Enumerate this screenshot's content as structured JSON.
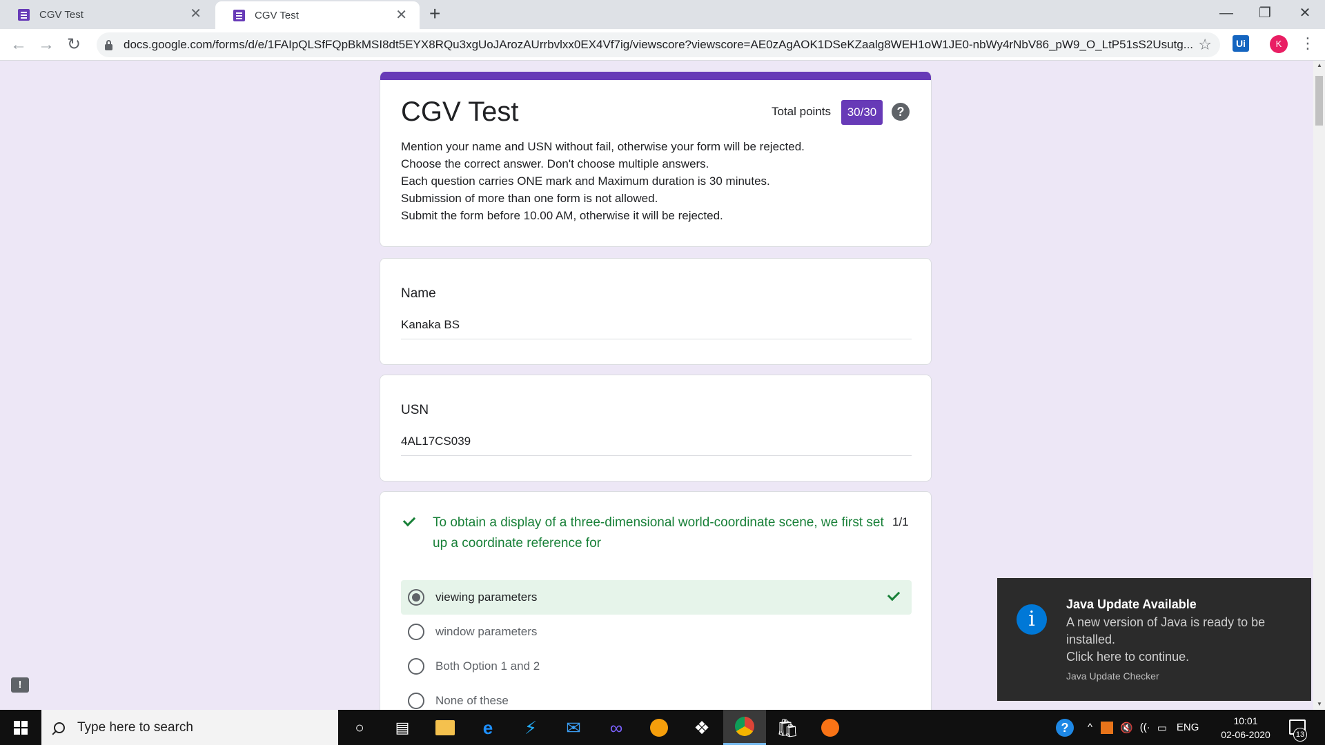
{
  "browser": {
    "tabs": [
      {
        "title": "CGV Test",
        "active": false
      },
      {
        "title": "CGV Test",
        "active": true
      }
    ],
    "new_tab_icon": "plus-icon",
    "window_controls": {
      "minimize": "—",
      "restore": "❐",
      "close": "✕"
    },
    "address": "docs.google.com/forms/d/e/1FAIpQLSfFQpBkMSI8dt5EYX8RQu3xgUoJArozAUrrbvlxx0EX4Vf7ig/viewscore?viewscore=AE0zAgAOK1DSeKZaalg8WEH1oW1JE0-nbWy4rNbV86_pW9_O_LtP51sS2Usutg...",
    "extension_label": "Ui",
    "profile_initial": "K"
  },
  "form": {
    "title": "CGV Test",
    "total_points_label": "Total points",
    "score": "30/30",
    "help_glyph": "?",
    "description": [
      "Mention your name and USN without fail, otherwise your form will be rejected.",
      "Choose the correct answer. Don't choose multiple answers.",
      "Each question carries ONE mark and Maximum duration is 30 minutes.",
      "Submission of more than one form is not allowed.",
      "Submit the form before 10.00 AM,  otherwise it will be rejected."
    ],
    "name_question": {
      "label": "Name",
      "answer": "Kanaka  BS"
    },
    "usn_question": {
      "label": "USN",
      "answer": "4AL17CS039"
    },
    "question_1": {
      "text": "To obtain a display of a three-dimensional world-coordinate scene, we first set up a coordinate reference for",
      "score": "1/1",
      "status": "correct",
      "options": [
        {
          "label": "viewing parameters",
          "selected": true,
          "correct": true
        },
        {
          "label": "window parameters",
          "selected": false,
          "correct": false
        },
        {
          "label": "Both Option 1 and 2",
          "selected": false,
          "correct": false
        },
        {
          "label": "None of these",
          "selected": false,
          "correct": false
        }
      ]
    },
    "colors": {
      "accent": "#673ab7",
      "correct": "#188038",
      "correct_bg": "#e6f4ea",
      "page_bg": "#ede7f6"
    }
  },
  "feedback_glyph": "!",
  "toast": {
    "title": "Java Update Available",
    "body": "A new version of Java is ready to be installed.",
    "action": "Click here to continue.",
    "source": "Java Update Checker",
    "icon_glyph": "i"
  },
  "taskbar": {
    "search_placeholder": "Type here to search",
    "apps": [
      "cortana-icon",
      "task-view-icon",
      "file-explorer-icon",
      "edge-icon",
      "visual-studio-code-icon",
      "mail-icon",
      "infinity-app-icon",
      "brave-icon",
      "dropbox-icon",
      "chrome-icon",
      "store-icon",
      "brave-icon"
    ],
    "tray": {
      "language": "ENG",
      "time": "10:01",
      "date": "02-06-2020",
      "notifications": "13"
    }
  }
}
